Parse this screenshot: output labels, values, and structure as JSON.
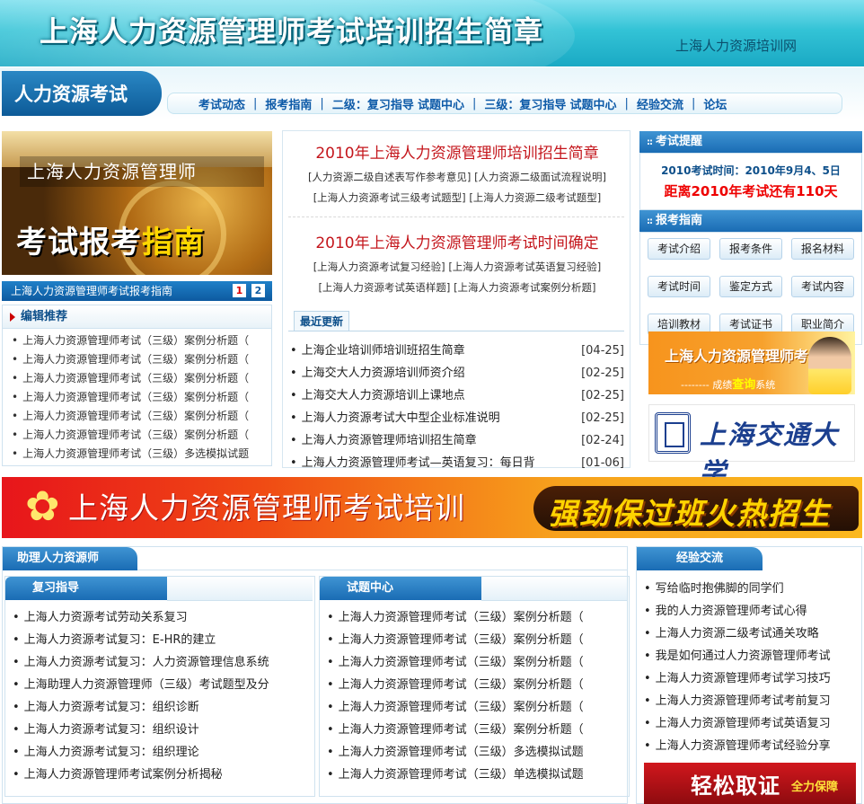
{
  "header": {
    "title": "上海人力资源管理师考试培训招生简章",
    "site_name": "上海人力资源培训网"
  },
  "nav": {
    "brand": "人力资源考试",
    "items": [
      "考试动态",
      "报考指南",
      "二级：复习指导",
      "试题中心",
      "三级：复习指导",
      "试题中心",
      "经验交流",
      "论坛"
    ]
  },
  "promo": {
    "line1": "上海人力资源管理师",
    "line2_a": "考试报考",
    "line2_b": "指南",
    "caption": "上海人力资源管理师考试报考指南",
    "pages": [
      "1",
      "2"
    ]
  },
  "recommend": {
    "title": "编辑推荐",
    "items": [
      "上海人力资源管理师考试（三级）案例分析题（",
      "上海人力资源管理师考试（三级）案例分析题（",
      "上海人力资源管理师考试（三级）案例分析题（",
      "上海人力资源管理师考试（三级）案例分析题（",
      "上海人力资源管理师考试（三级）案例分析题（",
      "上海人力资源管理师考试（三级）案例分析题（",
      "上海人力资源管理师考试（三级）多选模拟试题"
    ]
  },
  "news": {
    "headline1": "2010年上海人力资源管理师培训招生简章",
    "links1_row1": "[人力资源二级自述表写作参考意见] [人力资源二级面试流程说明]",
    "links1_row2": "[上海人力资源考试三级考试题型] [上海人力资源二级考试题型]",
    "headline2": "2010年上海人力资源管理师考试时间确定",
    "links2_row1": "[上海人力资源考试复习经验] [上海人力资源考试英语复习经验]",
    "links2_row2": "[上海人力资源考试英语样题] [上海人力资源考试案例分析题]",
    "latest_tab": "最近更新",
    "latest": [
      {
        "title": "上海企业培训师培训班招生简章",
        "date": "[04-25]"
      },
      {
        "title": "上海交大人力资源培训师资介绍",
        "date": "[02-25]"
      },
      {
        "title": "上海交大人力资源培训上课地点",
        "date": "[02-25]"
      },
      {
        "title": "上海人力资源考试大中型企业标准说明",
        "date": "[02-25]"
      },
      {
        "title": "上海人力资源管理师培训招生简章",
        "date": "[02-24]"
      },
      {
        "title": "上海人力资源管理师考试—英语复习：每日背",
        "date": "[01-06]"
      }
    ]
  },
  "reminder": {
    "title": "考试提醒",
    "date_line": "2010考试时间：2010年9月4、5日",
    "countdown": "距离2010年考试还有110天"
  },
  "guide": {
    "title": "报考指南",
    "buttons": [
      "考试介绍",
      "报考条件",
      "报名材料",
      "考试时间",
      "鉴定方式",
      "考试内容",
      "培训教材",
      "考试证书",
      "职业简介"
    ]
  },
  "ad_right": {
    "title": "上海人力资源管理师考试",
    "sub_prefix": "-------- 成绩",
    "sub_highlight": "查询",
    "sub_suffix": "系统",
    "university": "上海交通大学"
  },
  "banner": {
    "text": "上海人力资源管理师考试培训",
    "slogan": "强劲保过班火热招生"
  },
  "assistant": {
    "title": "助理人力资源师",
    "review": {
      "title": "复习指导",
      "items": [
        "上海人力资源考试劳动关系复习",
        "上海人力资源考试复习：E-HR的建立",
        "上海人力资源考试复习：人力资源管理信息系统",
        "上海助理人力资源管理师（三级）考试题型及分",
        "上海人力资源考试复习：组织诊断",
        "上海人力资源考试复习：组织设计",
        "上海人力资源考试复习：组织理论",
        "上海人力资源管理师考试案例分析揭秘"
      ]
    },
    "exam": {
      "title": "试题中心",
      "items": [
        "上海人力资源管理师考试（三级）案例分析题（",
        "上海人力资源管理师考试（三级）案例分析题（",
        "上海人力资源管理师考试（三级）案例分析题（",
        "上海人力资源管理师考试（三级）案例分析题（",
        "上海人力资源管理师考试（三级）案例分析题（",
        "上海人力资源管理师考试（三级）案例分析题（",
        "上海人力资源管理师考试（三级）多选模拟试题",
        "上海人力资源管理师考试（三级）单选模拟试题"
      ]
    }
  },
  "experience": {
    "title": "经验交流",
    "items": [
      "写给临时抱佛脚的同学们",
      "我的人力资源管理师考试心得",
      "上海人力资源二级考试通关攻略",
      "我是如何通过人力资源管理师考试",
      "上海人力资源管理师考试学习技巧",
      "上海人力资源管理师考试考前复习",
      "上海人力资源管理师考试英语复习",
      "上海人力资源管理师考试经验分享"
    ],
    "ad_text": "轻松取证",
    "ad_sub": "全力保障"
  }
}
